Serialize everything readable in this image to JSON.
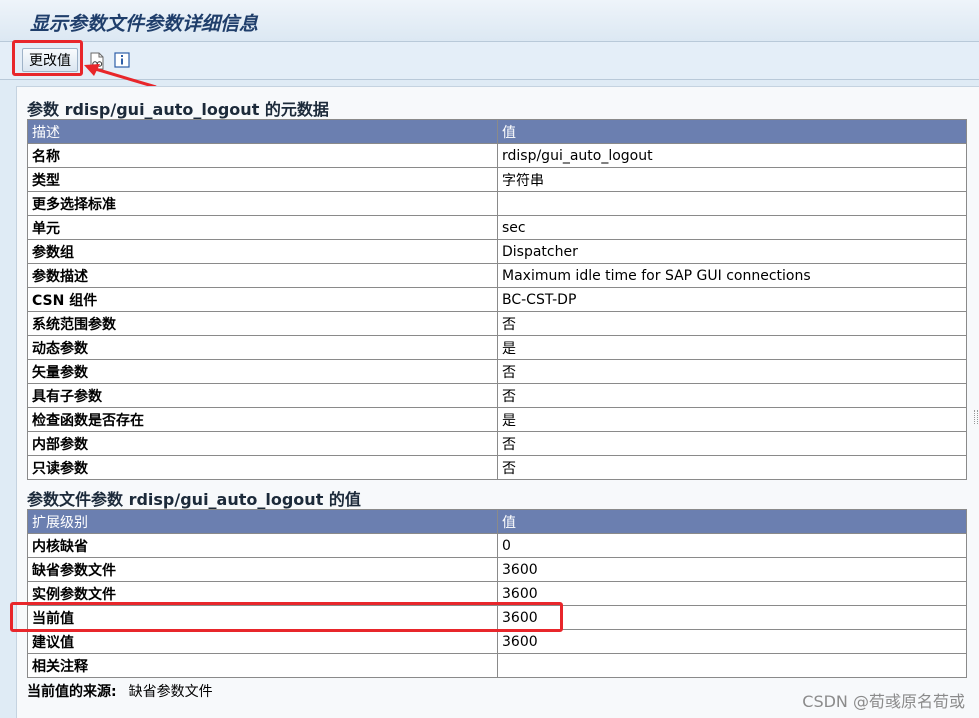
{
  "window": {
    "title": "显示参数文件参数详细信息"
  },
  "toolbar": {
    "change_label": "更改值",
    "icons": [
      "display-icon",
      "info-icon"
    ]
  },
  "metadata_section": {
    "title": "参数 rdisp/gui_auto_logout 的元数据",
    "headers": [
      "描述",
      "值"
    ],
    "rows": [
      {
        "label": "名称",
        "value": "rdisp/gui_auto_logout"
      },
      {
        "label": "类型",
        "value": "字符串"
      },
      {
        "label": "更多选择标准",
        "value": ""
      },
      {
        "label": "单元",
        "value": "sec"
      },
      {
        "label": "参数组",
        "value": "Dispatcher"
      },
      {
        "label": "参数描述",
        "value": "Maximum idle time for SAP GUI connections"
      },
      {
        "label": "CSN 组件",
        "value": "BC-CST-DP"
      },
      {
        "label": "系统范围参数",
        "value": "否"
      },
      {
        "label": "动态参数",
        "value": "是"
      },
      {
        "label": "矢量参数",
        "value": "否"
      },
      {
        "label": "具有子参数",
        "value": "否"
      },
      {
        "label": "检查函数是否存在",
        "value": "是"
      },
      {
        "label": "内部参数",
        "value": "否"
      },
      {
        "label": "只读参数",
        "value": "否"
      }
    ]
  },
  "values_section": {
    "title": "参数文件参数 rdisp/gui_auto_logout 的值",
    "headers": [
      "扩展级别",
      "值"
    ],
    "rows": [
      {
        "label": "内核缺省",
        "value": "0"
      },
      {
        "label": "缺省参数文件",
        "value": "3600"
      },
      {
        "label": "实例参数文件",
        "value": "3600"
      },
      {
        "label": "当前值",
        "value": "3600"
      },
      {
        "label": "建议值",
        "value": "3600"
      },
      {
        "label": "相关注释",
        "value": ""
      }
    ]
  },
  "source": {
    "label": "当前值的来源:",
    "value": "缺省参数文件"
  },
  "watermark": "CSDN @荀彧原名荀或",
  "colors": {
    "header_bg": "#6b7fb0",
    "annotation": "#e8262b",
    "background": "#dfebf5"
  }
}
